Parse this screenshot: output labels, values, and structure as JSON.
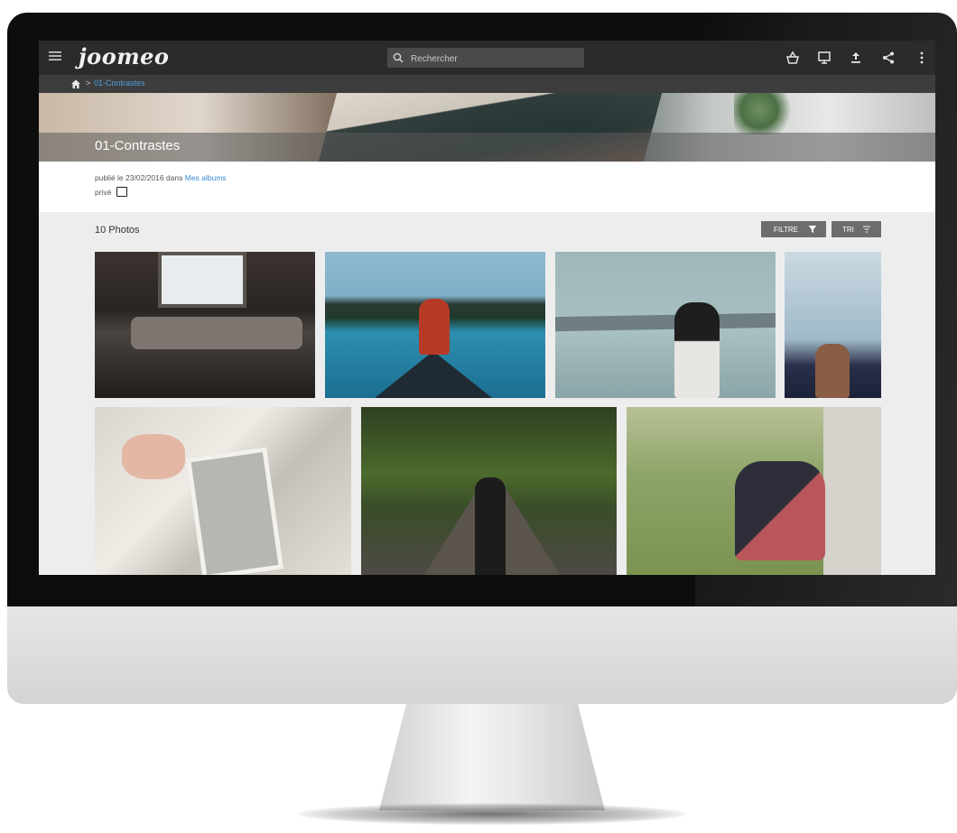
{
  "app": {
    "logo": "joomeo",
    "search_placeholder": "Rechercher"
  },
  "toolbar_icons": [
    "basket-icon",
    "slideshow-icon",
    "upload-icon",
    "share-icon",
    "more-vert-icon"
  ],
  "breadcrumb": {
    "home_icon": "home-icon",
    "separator": ">",
    "current": "01-Contrastes"
  },
  "album": {
    "title": "01-Contrastes",
    "published_prefix": "publié le 23/02/2016 dans ",
    "published_link": "Mes albums",
    "visibility": "privé"
  },
  "gallery": {
    "photo_count": "10 Photos",
    "filter_label": "FILTRE",
    "sort_label": "TRI"
  },
  "colors": {
    "topbar": "#2b2b2b",
    "breadcrumb_bar": "#3d3d3d",
    "link": "#3a8ad6",
    "gallery_bg": "#ededed",
    "button": "#6d6d6d"
  }
}
